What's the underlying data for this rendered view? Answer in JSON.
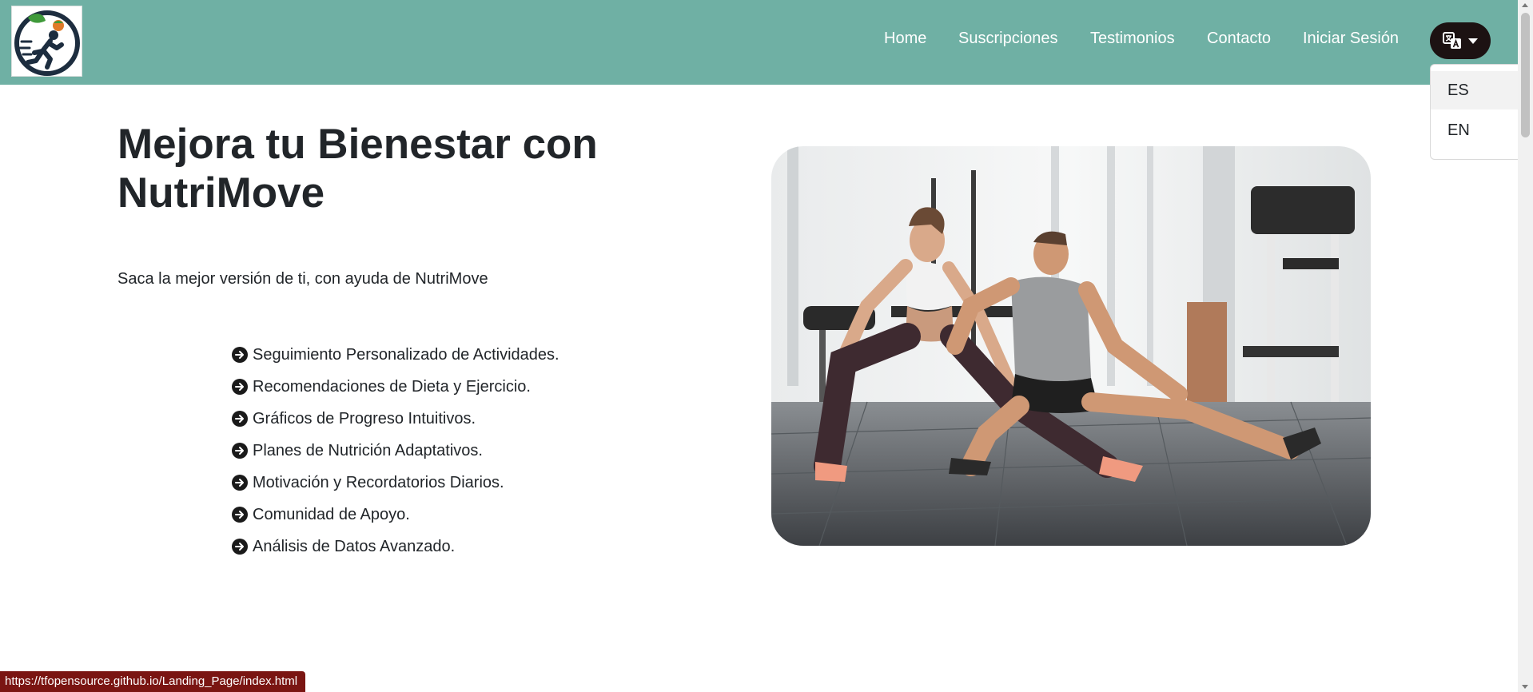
{
  "header": {
    "logo_alt": "NutriMove logo",
    "nav": [
      {
        "label": "Home"
      },
      {
        "label": "Suscripciones"
      },
      {
        "label": "Testimonios"
      },
      {
        "label": "Contacto"
      },
      {
        "label": "Iniciar Sesión"
      }
    ],
    "language_button_icon": "translate-icon",
    "language_options": [
      {
        "label": "ES",
        "selected": true
      },
      {
        "label": "EN",
        "selected": false
      }
    ]
  },
  "hero": {
    "title_line1": "Mejora tu Bienestar con",
    "title_line2": "NutriMove",
    "subtitle": "Saca la mejor versión de ti, con ayuda de NutriMove",
    "features": [
      "Seguimiento Personalizado de Actividades.",
      "Recomendaciones de Dieta y Ejercicio.",
      "Gráficos de Progreso Intuitivos.",
      "Planes de Nutrición Adaptativos.",
      "Motivación y Recordatorios Diarios.",
      "Comunidad de Apoyo.",
      "Análisis de Datos Avanzado."
    ],
    "feature_icon": "arrow-right-circle-icon"
  },
  "status_bar": {
    "url": "https://tfopensource.github.io/Landing_Page/index.html"
  },
  "colors": {
    "navbar": "#6fb0a4",
    "lang_button": "#1c1212",
    "status_bar": "#7a1512"
  }
}
